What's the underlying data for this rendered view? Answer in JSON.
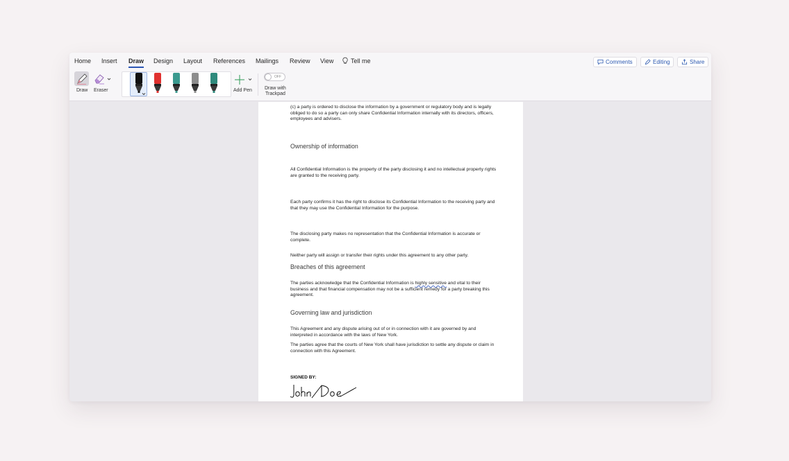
{
  "menu": {
    "tabs": [
      "Home",
      "Insert",
      "Draw",
      "Design",
      "Layout",
      "References",
      "Mailings",
      "Review",
      "View"
    ],
    "active_tab": "Draw",
    "tell_me": "Tell me"
  },
  "header_buttons": {
    "comments": "Comments",
    "editing": "Editing",
    "share": "Share"
  },
  "ribbon": {
    "draw_label": "Draw",
    "eraser_label": "Eraser",
    "pens": [
      {
        "name": "black-pen",
        "color": "#111111"
      },
      {
        "name": "red-pen",
        "color": "#e0312f"
      },
      {
        "name": "galaxy-pen",
        "color": "#3b9a8f"
      },
      {
        "name": "silver-pen",
        "color": "#8d8d8d"
      },
      {
        "name": "ocean-pen",
        "color": "#2f8a7c"
      }
    ],
    "add_pen_label": "Add Pen",
    "toggle_state": "OFF",
    "trackpad_label_1": "Draw with",
    "trackpad_label_2": "Trackpad"
  },
  "document": {
    "p1": "(c) a party is ordered to disclose the information by a government or regulatory body and is legally obliged to do so a party can only share Confidential Information internally with its directors, officers, employees and advisers.",
    "h1": "Ownership of information",
    "p2": "All Confidential Information is the property of the party disclosing it and no intellectual property rights are granted to the receiving party.",
    "p3": "Each party confirms it has the right to disclose its Confidential Information to the receiving party and that they may use the Confidential Information for the purpose.",
    "p4": "The disclosing party makes no representation that the Confidential Information is accurate or complete.",
    "p5": "Neither party will assign or transfer their rights under this agreement to any other party.",
    "h2": "Breaches of this agreement",
    "p6_a": "The parties acknowledge that the Confidential Information is ",
    "p6_highlight": "highly sensitive",
    "p6_b": " and vital to their business and that financial compensation may not be a sufficient remedy for a party breaking this agreement.",
    "h3": "Governing law and jurisdiction",
    "p7": "This Agreement and any dispute arising out of or in connection with it are governed by and interpreted in accordance with the laws of New York.",
    "p8": "The parties agree that the courts of New York shall have jurisdiction to settle any dispute or claim in connection with this Agreement.",
    "signed_by": "SIGNED BY:",
    "signature": "John Doe"
  }
}
